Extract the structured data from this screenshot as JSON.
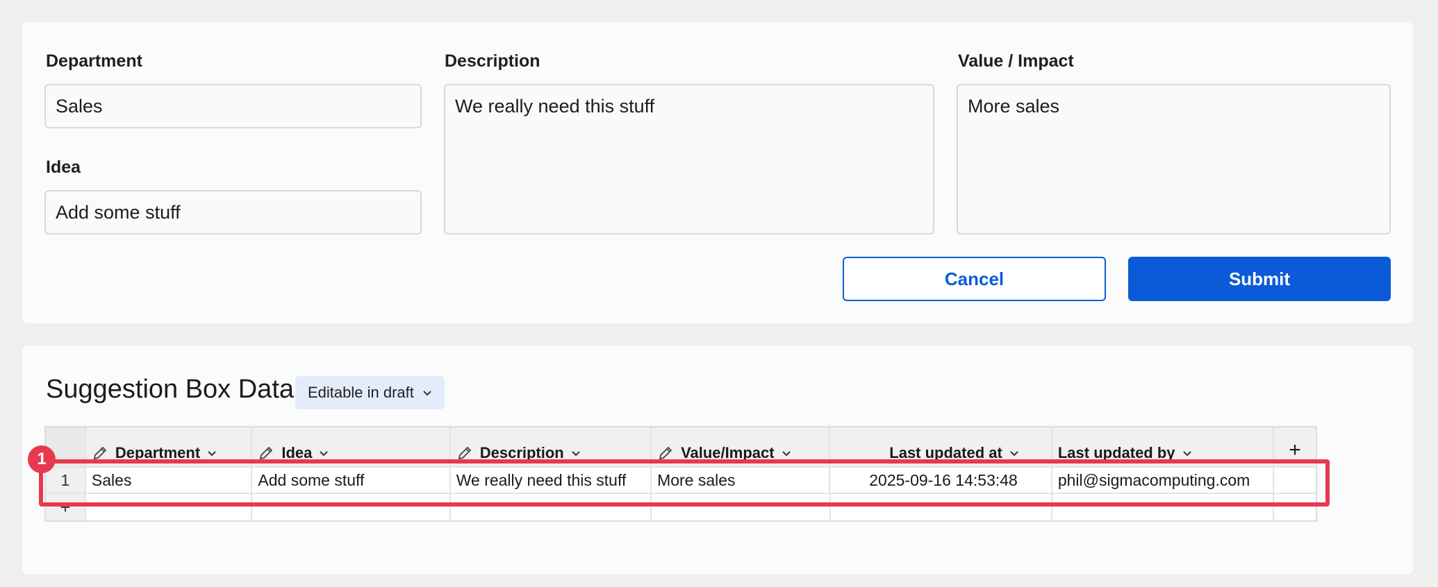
{
  "form": {
    "department": {
      "label": "Department",
      "value": "Sales"
    },
    "idea": {
      "label": "Idea",
      "value": "Add some stuff"
    },
    "description": {
      "label": "Description",
      "value": "We really need this stuff"
    },
    "value_impact": {
      "label": "Value / Impact",
      "value": "More sales"
    },
    "cancel_label": "Cancel",
    "submit_label": "Submit"
  },
  "table": {
    "title": "Suggestion Box Data",
    "badge": "Editable in draft",
    "columns": [
      {
        "label": "Department",
        "editable": true
      },
      {
        "label": "Idea",
        "editable": true
      },
      {
        "label": "Description",
        "editable": true
      },
      {
        "label": "Value/Impact",
        "editable": true
      },
      {
        "label": "Last updated at",
        "editable": false
      },
      {
        "label": "Last updated by",
        "editable": false
      }
    ],
    "add_column": "+",
    "rows": [
      {
        "index": "1",
        "cells": [
          "Sales",
          "Add some stuff",
          "We really need this stuff",
          "More sales",
          "2025-09-16 14:53:48",
          "phil@sigmacomputing.com"
        ]
      }
    ],
    "add_row": "+"
  },
  "annotation": {
    "marker": "1",
    "color": "#e8384f"
  },
  "colors": {
    "accent": "#0b5bd8",
    "highlight": "#e8384f"
  }
}
